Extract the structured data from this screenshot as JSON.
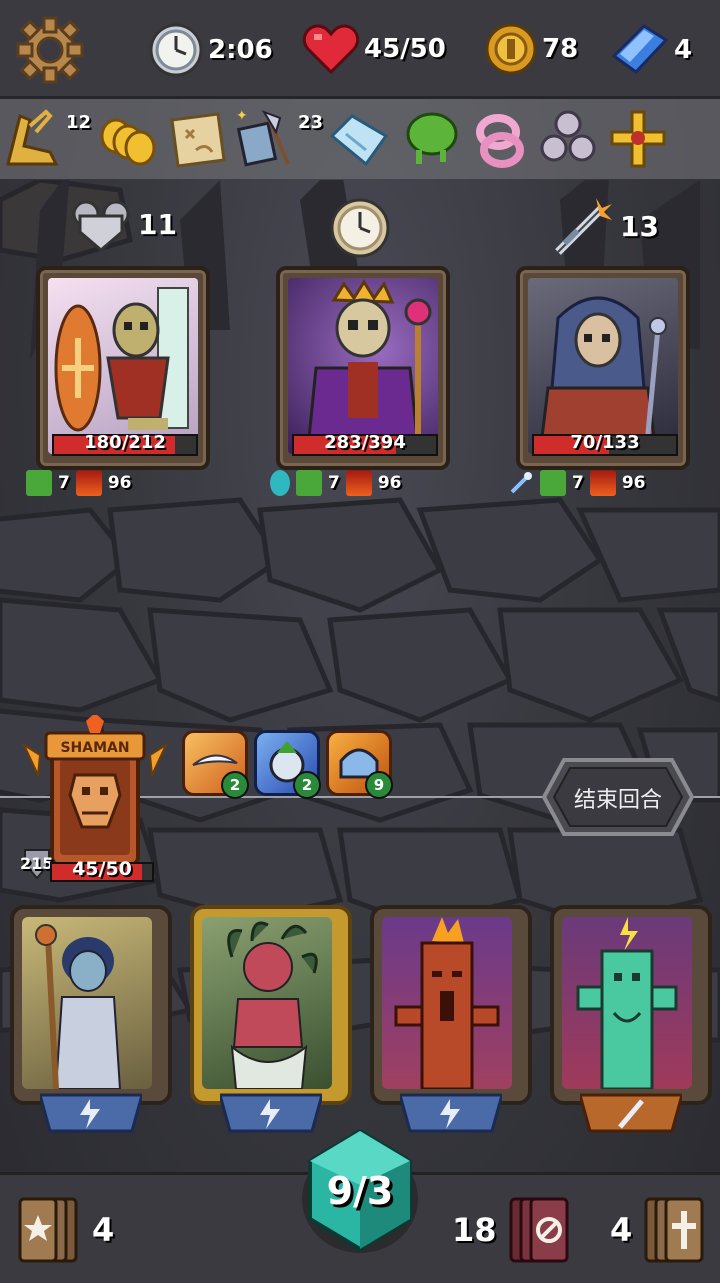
{
  "topbar": {
    "timer": "2:06",
    "health": "45/50",
    "gold": "78",
    "gems": "4",
    "icons": [
      "settings-gear-icon",
      "clock-icon",
      "heart-icon",
      "gold-coin-icon",
      "blue-gem-icon"
    ]
  },
  "relics": [
    {
      "name": "golden-boot-icon",
      "count": ""
    },
    {
      "name": "coin-stack-icon",
      "count": "12"
    },
    {
      "name": "treasure-map-icon",
      "count": ""
    },
    {
      "name": "axe-book-icon",
      "count": "23"
    },
    {
      "name": "ice-shard-icon",
      "count": ""
    },
    {
      "name": "green-slime-icon",
      "count": ""
    },
    {
      "name": "pink-ring-icon",
      "count": ""
    },
    {
      "name": "triskelion-icon",
      "count": ""
    },
    {
      "name": "golden-cross-icon",
      "count": ""
    }
  ],
  "enemies": [
    {
      "name": "skeleton-warrior",
      "intent_icon": "shield-intent-icon",
      "intent_value": "11",
      "hp_text": "180/212",
      "hp_fraction": 0.849,
      "statuses": [
        {
          "icon": "poison-status-icon",
          "value": "7"
        },
        {
          "icon": "burn-status-icon",
          "value": "96"
        }
      ]
    },
    {
      "name": "skeleton-king",
      "intent_icon": "clock-intent-icon",
      "intent_value": "",
      "hp_text": "283/394",
      "hp_fraction": 0.718,
      "statuses": [
        {
          "icon": "skull-gem-status-icon",
          "value": ""
        },
        {
          "icon": "poison-status-icon",
          "value": "7"
        },
        {
          "icon": "burn-status-icon",
          "value": "96"
        }
      ]
    },
    {
      "name": "hooded-skeleton-mage",
      "intent_icon": "sword-attack-intent-icon",
      "intent_value": "13",
      "hp_text": "70/133",
      "hp_fraction": 0.526,
      "statuses": [
        {
          "icon": "wand-status-icon",
          "value": ""
        },
        {
          "icon": "poison-status-icon",
          "value": "7"
        },
        {
          "icon": "burn-status-icon",
          "value": "96"
        }
      ]
    }
  ],
  "hero": {
    "class_label": "SHAMAN",
    "hp_text": "45/50",
    "hp_fraction": 0.9,
    "armor": "215"
  },
  "buffs": [
    {
      "name": "wind-buff-icon",
      "value": "2"
    },
    {
      "name": "clock-up-buff-icon",
      "value": "2"
    },
    {
      "name": "helmet-buff-icon",
      "value": "9"
    }
  ],
  "end_turn_label": "结束回合",
  "hand": [
    {
      "name": "card-staff-girl",
      "type_icon": "lightning-type-icon",
      "gold": false
    },
    {
      "name": "card-medusa",
      "type_icon": "lightning-type-icon",
      "gold": true
    },
    {
      "name": "card-fire-totem",
      "type_icon": "lightning-type-icon",
      "gold": false
    },
    {
      "name": "card-lightning-totem",
      "type_icon": "sword-type-icon",
      "gold": false
    }
  ],
  "energy": "9/3",
  "piles": {
    "draw": "4",
    "discard": "18",
    "exhaust": "4"
  },
  "colors": {
    "hp": "#d12c2c",
    "energy": "#2bb5a3",
    "badge": "#2a8a3a"
  }
}
